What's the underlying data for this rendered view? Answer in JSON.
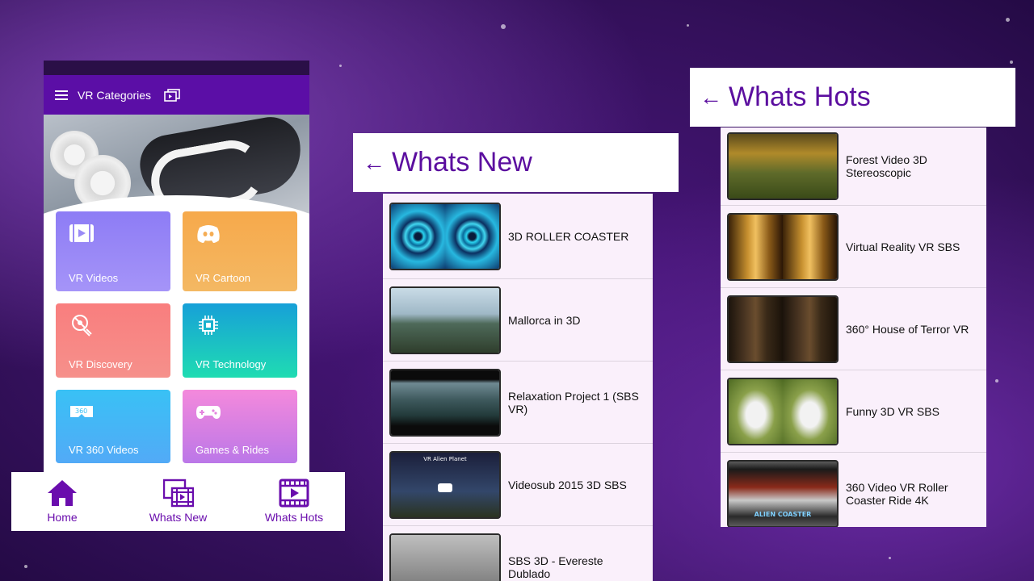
{
  "app": {
    "title": "VR Categories",
    "categories": [
      {
        "label": "VR Videos",
        "icon": "video-play-icon"
      },
      {
        "label": "VR Cartoon",
        "icon": "discord-icon"
      },
      {
        "label": "VR Discovery",
        "icon": "satellite-dish-icon"
      },
      {
        "label": "VR Technology",
        "icon": "chip-icon"
      },
      {
        "label": "VR 360 Videos",
        "icon": "vr-360-icon"
      },
      {
        "label": "Games & Rides",
        "icon": "gamepad-icon"
      }
    ],
    "bottom_nav": [
      {
        "label": "Home",
        "icon": "home-icon"
      },
      {
        "label": "Whats New",
        "icon": "film-icon"
      },
      {
        "label": "Whats Hots",
        "icon": "play-film-icon"
      }
    ]
  },
  "whats_new": {
    "title": "Whats New",
    "items": [
      {
        "title": "3D ROLLER COASTER"
      },
      {
        "title": "Mallorca in 3D"
      },
      {
        "title": "Relaxation Project 1 (SBS VR)"
      },
      {
        "title": "Videosub 2015 3D SBS",
        "thumb_caption": "VR Alien Planet"
      },
      {
        "title": "SBS 3D - Evereste Dublado"
      }
    ]
  },
  "whats_hots": {
    "title": "Whats Hots",
    "items": [
      {
        "title": "Forest Video 3D Stereoscopic"
      },
      {
        "title": "Virtual Reality VR SBS"
      },
      {
        "title": "360° House of Terror VR"
      },
      {
        "title": "Funny 3D VR SBS"
      },
      {
        "title": "360 Video VR Roller Coaster Ride 4K",
        "thumb_caption": "ALIEN COASTER"
      }
    ]
  },
  "colors": {
    "primary": "#5b0ea6",
    "accent_text": "#5b0e9f",
    "list_bg": "#faf0fb"
  }
}
